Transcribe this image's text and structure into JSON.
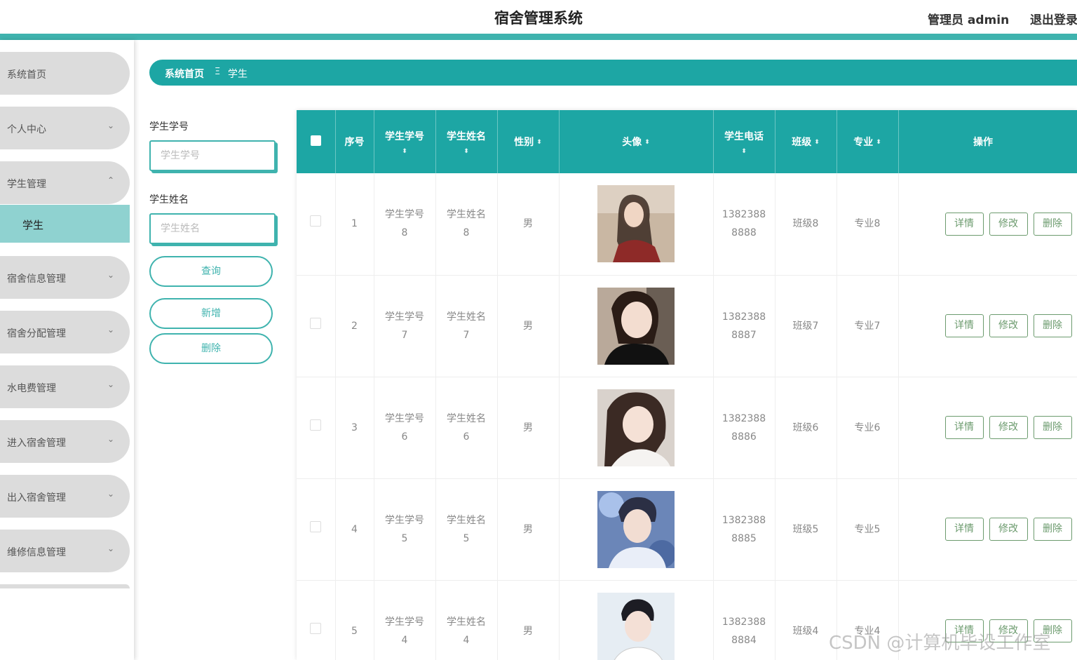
{
  "header": {
    "title": "宿舍管理系统",
    "user": "管理员 admin",
    "logout": "退出登录"
  },
  "sidebar": {
    "items": [
      {
        "label": "系统首页",
        "chevron": ""
      },
      {
        "label": "个人中心",
        "chevron": "⌄"
      },
      {
        "label": "学生管理",
        "chevron": "⌃"
      },
      {
        "label": "宿舍信息管理",
        "chevron": "⌄"
      },
      {
        "label": "宿舍分配管理",
        "chevron": "⌄"
      },
      {
        "label": "水电费管理",
        "chevron": "⌄"
      },
      {
        "label": "进入宿舍管理",
        "chevron": "⌄"
      },
      {
        "label": "出入宿舍管理",
        "chevron": "⌄"
      },
      {
        "label": "维修信息管理",
        "chevron": "⌄"
      }
    ],
    "active_sub": "学生"
  },
  "breadcrumb": {
    "home": "系统首页",
    "separator": "Ξ",
    "current": "学生"
  },
  "search": {
    "student_no_label": "学生学号",
    "student_no_placeholder": "学生学号",
    "student_no_value": "",
    "student_name_label": "学生姓名",
    "student_name_placeholder": "学生姓名",
    "student_name_value": "",
    "query_button": "查询",
    "add_button": "新增",
    "delete_button": "删除"
  },
  "table": {
    "columns": {
      "index": "序号",
      "student_no": "学生学号",
      "student_name": "学生姓名",
      "gender": "性别",
      "avatar": "头像",
      "phone": "学生电话",
      "class": "班级",
      "major": "专业",
      "actions": "操作"
    },
    "sort_icon": "⬍",
    "action_labels": {
      "detail": "详情",
      "edit": "修改",
      "delete": "删除"
    },
    "rows": [
      {
        "index": "1",
        "no_a": "学生学号",
        "no_b": "8",
        "name_a": "学生姓名",
        "name_b": "8",
        "gender": "男",
        "phone_a": "1382388",
        "phone_b": "8888",
        "class": "班级8",
        "major": "专业8",
        "avatar": "photo-woman-red-top"
      },
      {
        "index": "2",
        "no_a": "学生学号",
        "no_b": "7",
        "name_a": "学生姓名",
        "name_b": "7",
        "gender": "男",
        "phone_a": "1382388",
        "phone_b": "8887",
        "class": "班级7",
        "major": "专业7",
        "avatar": "photo-woman-black-top"
      },
      {
        "index": "3",
        "no_a": "学生学号",
        "no_b": "6",
        "name_a": "学生姓名",
        "name_b": "6",
        "gender": "男",
        "phone_a": "1382388",
        "phone_b": "8886",
        "class": "班级6",
        "major": "专业6",
        "avatar": "photo-woman-white-top"
      },
      {
        "index": "4",
        "no_a": "学生学号",
        "no_b": "5",
        "name_a": "学生姓名",
        "name_b": "5",
        "gender": "男",
        "phone_a": "1382388",
        "phone_b": "8885",
        "class": "班级5",
        "major": "专业5",
        "avatar": "photo-man-blue-background"
      },
      {
        "index": "5",
        "no_a": "学生学号",
        "no_b": "4",
        "name_a": "学生姓名",
        "name_b": "4",
        "gender": "男",
        "phone_a": "1382388",
        "phone_b": "8884",
        "class": "班级4",
        "major": "专业4",
        "avatar": "photo-man-white-shirt"
      }
    ]
  },
  "watermark": "CSDN @计算机毕设工作室",
  "colors": {
    "accent": "#1da6a4",
    "header_bar": "#3fb3ae",
    "sub_active": "#8fd2d0",
    "menu_bg": "#dcdcdc",
    "action_btn": "#6c9b6e"
  }
}
